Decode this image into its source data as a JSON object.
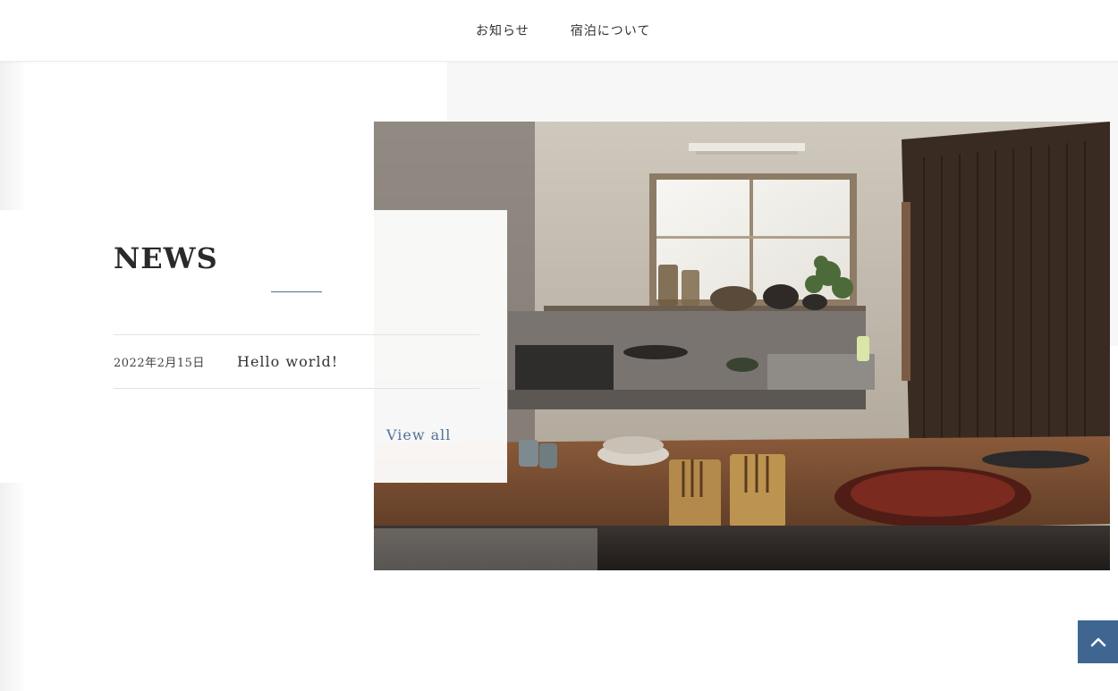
{
  "nav": {
    "items": [
      {
        "label": "お知らせ"
      },
      {
        "label": "宿泊について"
      }
    ]
  },
  "news": {
    "title": "NEWS",
    "items": [
      {
        "date": "2022年2月15日",
        "title": "Hello world!"
      }
    ],
    "view_all_label": "View all"
  },
  "back_to_top": {
    "icon": "chevron-up-icon"
  },
  "colors": {
    "accent": "#3e6690",
    "link": "#4f7399",
    "text": "#333333"
  }
}
